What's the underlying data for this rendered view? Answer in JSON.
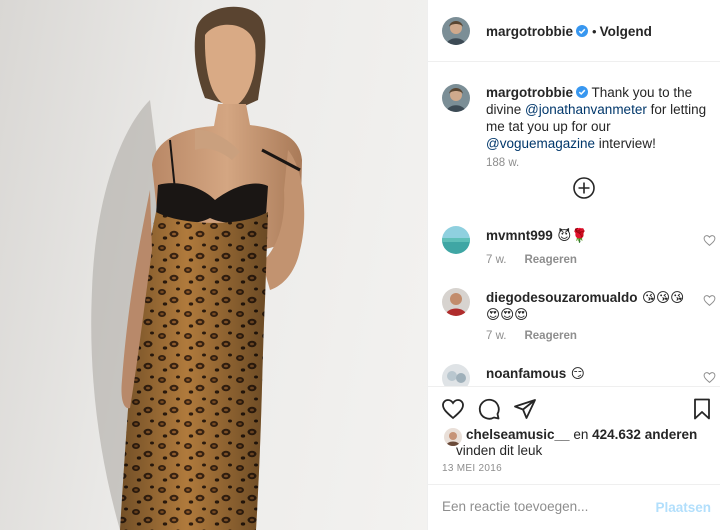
{
  "post": {
    "author": "margotrobbie",
    "follow_separator": "•",
    "follow_label": "Volgend",
    "verified": true
  },
  "caption": {
    "author": "margotrobbie",
    "text_1": "Thank you to the divine",
    "mention_1": "@jonathanvanmeter",
    "text_2": "for letting me tat you up for our",
    "mention_2": "@voguemagazine",
    "text_3": "interview!",
    "age": "188 w."
  },
  "comments": [
    {
      "user": "mvmnt999",
      "text": "😈🌹",
      "age": "7 w.",
      "reply": "Reageren"
    },
    {
      "user": "diegodesouzaromualdo",
      "text": "😘😘😘",
      "text_line2": "😍😍😍",
      "age": "7 w.",
      "reply": "Reageren"
    },
    {
      "user": "noanfamous",
      "text": "😏"
    }
  ],
  "likes": {
    "user": "chelseamusic__",
    "connector": "en",
    "count": "424.632 anderen",
    "suffix": "vinden dit leuk"
  },
  "date": "13 MEI 2016",
  "comment_box": {
    "placeholder": "Een reactie toevoegen...",
    "post_label": "Plaatsen"
  },
  "colors": {
    "verified_badge": "#3897f0",
    "mention": "#00376b",
    "post_disabled": "#b2dffc",
    "muted": "#8e8e8e"
  },
  "icons": [
    "heart-icon",
    "comment-icon",
    "share-icon",
    "bookmark-icon",
    "load-more-icon",
    "verified-badge-icon"
  ]
}
